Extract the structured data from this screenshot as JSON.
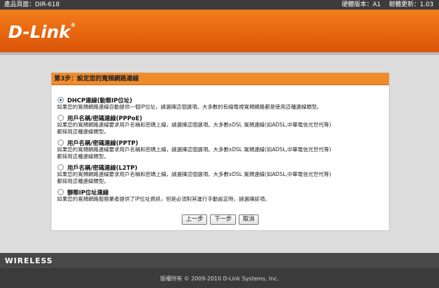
{
  "topbar": {
    "product": "產品頁面：DIR-618",
    "versions": "硬體版本：A1　 韌體更新：1.03"
  },
  "brand": {
    "logo": "D-Link",
    "reg": "®"
  },
  "panel": {
    "title": "第3步：設定您的寬頻網路連線",
    "options": [
      {
        "label": "DHCP連線(動態IP位址)",
        "checked": true,
        "desc1": "如果您的寬頻網路連線自動提供一個IP位址，請選擇這個選項。大多數的有線電視寬頻網路都是使用這種連線類型。",
        "desc2": ""
      },
      {
        "label": "用戶名稱/密碼連線(PPPoE)",
        "checked": false,
        "desc1": "如果您的寬頻網路連線要求用戶名稱和密碼上線，請選擇這個選項。大多數xDSL 寬頻連線(如ADSL,中華電信光世代等)",
        "desc2": "都採用這種連線類型。"
      },
      {
        "label": "用戶名稱/密碼連線(PPTP)",
        "checked": false,
        "desc1": "如果您的寬頻網路連線要求用戶名稱和密碼上線，請選擇這個選項。大多數xDSL 寬頻連線(如ADSL,中華電信光世代等)",
        "desc2": "都採用這種連線類型。"
      },
      {
        "label": "用戶名稱/密碼連線(L2TP)",
        "checked": false,
        "desc1": "如果您的寬頻網路連線要求用戶名稱和密碼上線，請選擇這個選項。大多數xDSL 寬頻連線(如ADSL,中華電信光世代等)",
        "desc2": "都採用這種連線類型。"
      },
      {
        "label": "靜態IP位址連線",
        "checked": false,
        "desc1": "如果您的寬頻網路服務業者提供了IP位址資訊，但是必須對其進行手動設定時，請選擇該項。",
        "desc2": ""
      }
    ],
    "buttons": {
      "prev": "上一步",
      "next": "下一步",
      "cancel": "取消"
    }
  },
  "footer": {
    "wireless": "WIRELESS",
    "copyright": "版權所有 © 2009-2010 D-Link Systems, Inc."
  }
}
